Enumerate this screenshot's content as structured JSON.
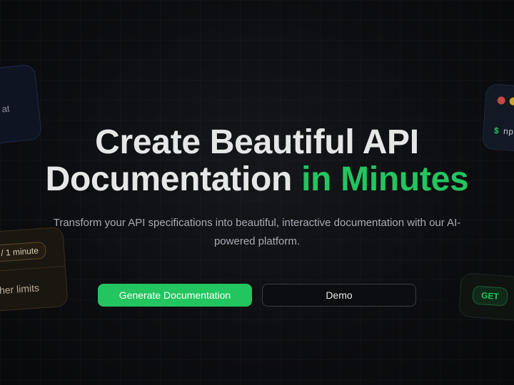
{
  "hero": {
    "headline_line1": "Create Beautiful API",
    "headline_line2_plain": "Documentation",
    "headline_line2_accent": "in Minutes",
    "subtitle": "Transform your API specifications into beautiful, interactive documentation with our AI-powered platform."
  },
  "actions": {
    "primary_label": "Generate Documentation",
    "secondary_label": "Demo"
  },
  "floating_cards": {
    "chat_text": "at",
    "terminal_prompt": "$",
    "terminal_text": "np",
    "rate_pill": "/ 1 minute",
    "rate_text": "her limits",
    "method_badge": "GET"
  },
  "colors": {
    "accent": "#22c55e",
    "background": "#0b0c0e",
    "text_primary": "#e6e6e6",
    "text_secondary": "#a7abb3"
  }
}
